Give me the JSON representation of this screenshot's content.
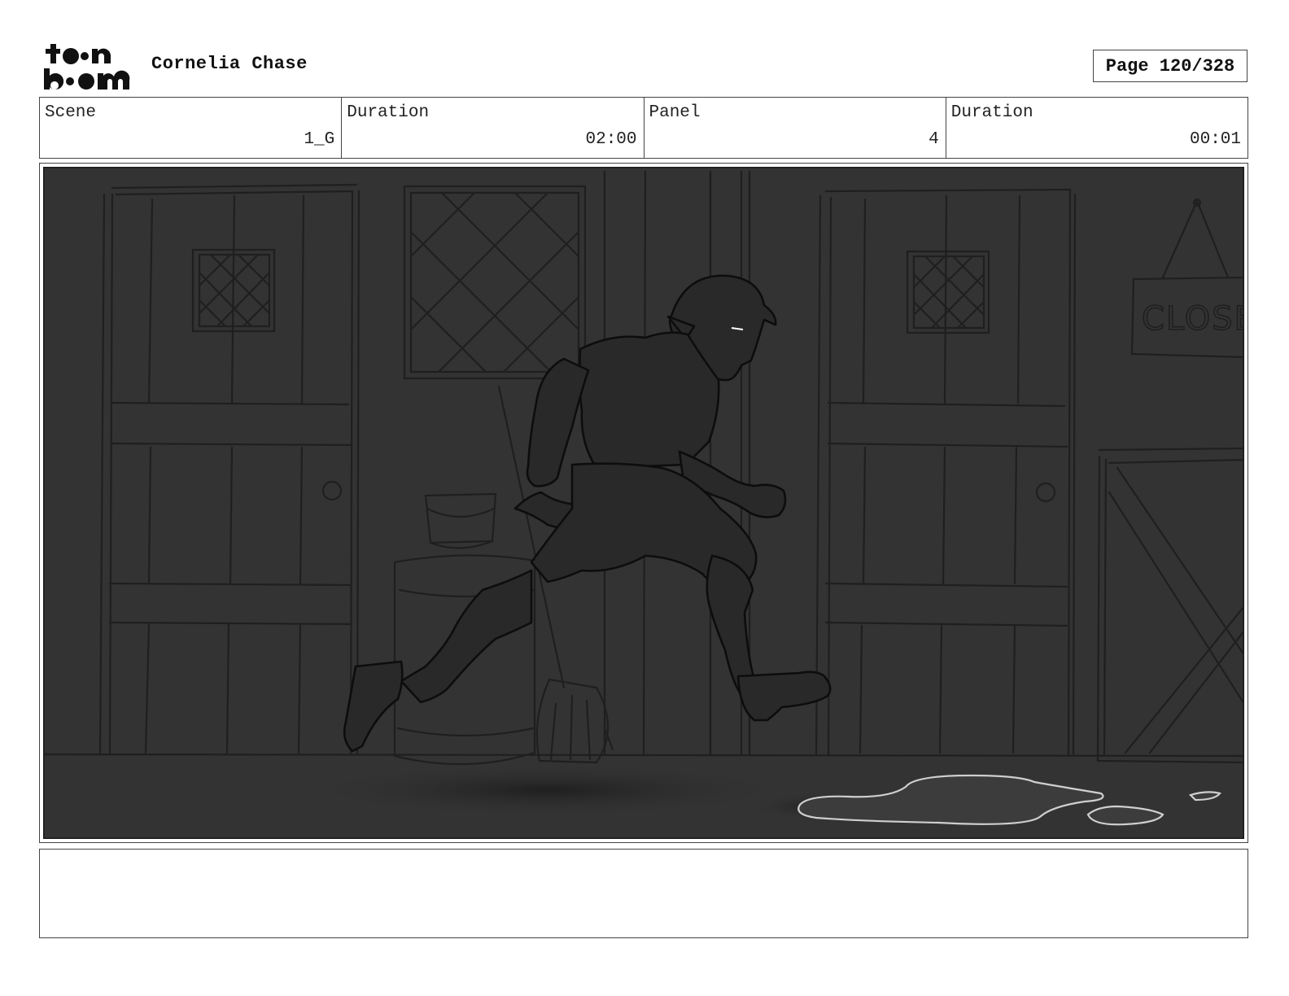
{
  "header": {
    "logo_top": "toon",
    "logo_bottom": "boom",
    "project_title": "Cornelia Chase",
    "page_label": "Page 120/328"
  },
  "info": {
    "scene_label": "Scene",
    "scene_value": "1_G",
    "scene_duration_label": "Duration",
    "scene_duration_value": "02:00",
    "panel_label": "Panel",
    "panel_value": "4",
    "panel_duration_label": "Duration",
    "panel_duration_value": "00:01"
  },
  "panel": {
    "sign_text": "CLOSE"
  },
  "notes": {
    "text": ""
  }
}
